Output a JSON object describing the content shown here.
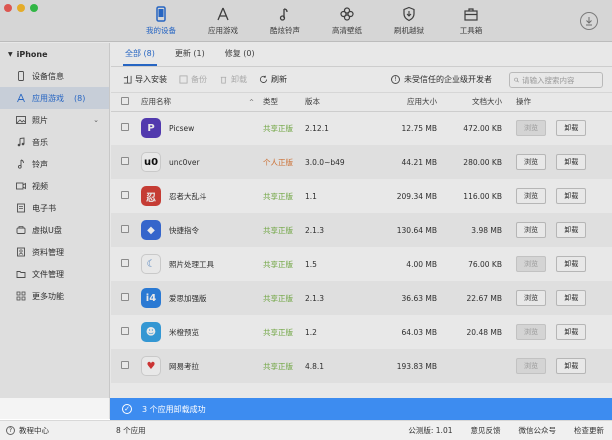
{
  "toolbar": {
    "nav": [
      {
        "label": "我的设备",
        "icon": "phone-icon",
        "active": true
      },
      {
        "label": "应用游戏",
        "icon": "app-store-icon",
        "active": false
      },
      {
        "label": "酷炫铃声",
        "icon": "music-note-icon",
        "active": false
      },
      {
        "label": "高清壁纸",
        "icon": "flower-icon",
        "active": false
      },
      {
        "label": "刷机越狱",
        "icon": "shield-icon",
        "active": false
      },
      {
        "label": "工具箱",
        "icon": "toolbox-icon",
        "active": false
      }
    ],
    "download_icon": "download-icon"
  },
  "sidebar": {
    "device": "iPhone",
    "items": [
      {
        "label": "设备信息",
        "icon": "phone-info-icon"
      },
      {
        "label": "应用游戏",
        "icon": "app-store-icon",
        "count": "(8)",
        "active": true
      },
      {
        "label": "照片",
        "icon": "photo-icon",
        "chevron": true
      },
      {
        "label": "音乐",
        "icon": "music-icon"
      },
      {
        "label": "铃声",
        "icon": "bell-icon"
      },
      {
        "label": "视频",
        "icon": "video-icon"
      },
      {
        "label": "电子书",
        "icon": "book-icon"
      },
      {
        "label": "虚拟U盘",
        "icon": "usb-icon"
      },
      {
        "label": "资料管理",
        "icon": "contacts-icon"
      },
      {
        "label": "文件管理",
        "icon": "folder-icon"
      },
      {
        "label": "更多功能",
        "icon": "grid-icon"
      }
    ]
  },
  "tabs": [
    {
      "label": "全部 (8)",
      "active": true
    },
    {
      "label": "更新 (1)",
      "active": false
    },
    {
      "label": "修复 (0)",
      "active": false
    }
  ],
  "actions": {
    "import": "导入安装",
    "backup": "备份",
    "uninstall": "卸载",
    "refresh": "刷新",
    "warning": "未受信任的企业级开发者",
    "search_placeholder": "请输入搜索内容"
  },
  "table": {
    "headers": {
      "name": "应用名称",
      "type": "类型",
      "version": "版本",
      "app_size": "应用大小",
      "doc_size": "文档大小",
      "ops": "操作"
    },
    "rows": [
      {
        "name": "Picsew",
        "type": "共享正版",
        "type_class": "shared",
        "version": "2.12.1",
        "app_size": "12.75 MB",
        "doc_size": "472.00 KB",
        "browse": "浏览",
        "browse_disabled": true,
        "uninstall": "卸载",
        "icon": "picsew-icon",
        "color": "#5a3fc0"
      },
      {
        "name": "unc0ver",
        "type": "个人正版",
        "type_class": "personal",
        "version": "3.0.0~b49",
        "app_size": "44.21 MB",
        "doc_size": "280.00 KB",
        "browse": "浏览",
        "browse_disabled": false,
        "uninstall": "卸载",
        "icon": "unc0ver-icon",
        "color": "#ffffff"
      },
      {
        "name": "忍者大乱斗",
        "type": "共享正版",
        "type_class": "shared",
        "version": "1.1",
        "app_size": "209.34 MB",
        "doc_size": "116.00 KB",
        "browse": "浏览",
        "browse_disabled": false,
        "uninstall": "卸载",
        "icon": "ninja-game-icon",
        "color": "#d9433a"
      },
      {
        "name": "快捷指令",
        "type": "共享正版",
        "type_class": "shared",
        "version": "2.1.3",
        "app_size": "130.64 MB",
        "doc_size": "3.98 MB",
        "browse": "浏览",
        "browse_disabled": false,
        "uninstall": "卸载",
        "icon": "shortcuts-icon",
        "color": "#3b6fe0"
      },
      {
        "name": "照片处理工具",
        "type": "共享正版",
        "type_class": "shared",
        "version": "1.5",
        "app_size": "4.00 MB",
        "doc_size": "76.00 KB",
        "browse": "浏览",
        "browse_disabled": true,
        "uninstall": "卸载",
        "icon": "photo-tool-icon",
        "color": "#ffffff"
      },
      {
        "name": "爱思加强版",
        "type": "共享正版",
        "type_class": "shared",
        "version": "2.1.3",
        "app_size": "36.63 MB",
        "doc_size": "22.67 MB",
        "browse": "浏览",
        "browse_disabled": false,
        "uninstall": "卸载",
        "icon": "i4-icon",
        "color": "#2f86e8"
      },
      {
        "name": "米橙预览",
        "type": "共享正版",
        "type_class": "shared",
        "version": "1.2",
        "app_size": "64.03 MB",
        "doc_size": "20.48 MB",
        "browse": "浏览",
        "browse_disabled": true,
        "uninstall": "卸载",
        "icon": "preview-icon",
        "color": "#3aa6e8"
      },
      {
        "name": "网易考拉",
        "type": "共享正版",
        "type_class": "shared",
        "version": "4.8.1",
        "app_size": "193.83 MB",
        "doc_size": "",
        "browse": "浏览",
        "browse_disabled": true,
        "uninstall": "卸载",
        "icon": "kaola-icon",
        "color": "#ffffff"
      }
    ]
  },
  "toast": "3 个应用卸载成功",
  "status": {
    "help": "教程中心",
    "count": "8 个应用",
    "version": "公测版: 1.01",
    "feedback": "意见反馈",
    "wechat": "微信公众号",
    "update": "检查更新"
  }
}
